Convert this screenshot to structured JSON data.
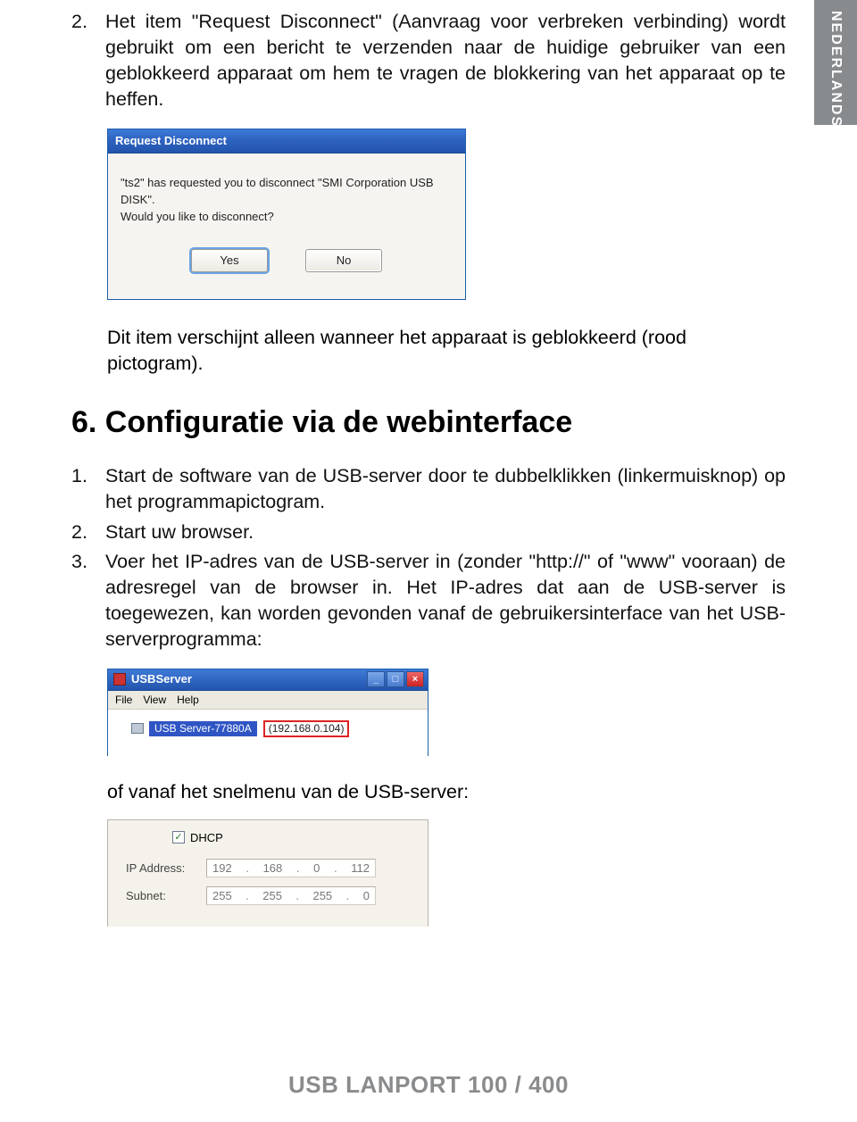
{
  "lang_tab": "NEDERLANDS",
  "intro": {
    "num": "2.",
    "text": "Het item \"Request Disconnect\" (Aanvraag voor verbreken verbinding) wordt gebruikt om een bericht te verzenden naar de huidige gebruiker van een geblokkeerd apparaat om hem te vragen de blokkering van het apparaat op te heffen."
  },
  "dialog": {
    "title": "Request Disconnect",
    "line1": "\"ts2\" has requested you to disconnect \"SMI Corporation USB DISK\".",
    "line2": "Would you like to disconnect?",
    "yes": "Yes",
    "no": "No"
  },
  "note": "Dit item verschijnt alleen wanneer het apparaat is geblokkeerd (rood pictogram).",
  "section_heading": "6. Configuratie via de webinterface",
  "steps": [
    {
      "num": "1.",
      "text": "Start de software van de USB-server door te dubbelklikken (linkermuisknop) op het programmapictogram."
    },
    {
      "num": "2.",
      "text": "Start uw browser."
    },
    {
      "num": "3.",
      "text": "Voer het IP-adres van de USB-server in (zonder \"http://\" of \"www\" vooraan) de adresregel van de browser in. Het IP-adres dat aan de USB-server is toegewezen, kan worden gevonden vanaf de gebruikersinterface van het USB-serverprogramma:"
    }
  ],
  "usbwin": {
    "title": "USBServer",
    "menus": [
      "File",
      "View",
      "Help"
    ],
    "server_name": "USB Server-77880A",
    "server_ip": "(192.168.0.104)"
  },
  "shortcut_text": "of vanaf het snelmenu van de USB-server:",
  "netpanel": {
    "dhcp_label": "DHCP",
    "ip_label": "IP Address:",
    "subnet_label": "Subnet:",
    "ip": [
      "192",
      "168",
      "0",
      "112"
    ],
    "subnet": [
      "255",
      "255",
      "255",
      "0"
    ]
  },
  "footer": "USB LANPORT 100 / 400"
}
